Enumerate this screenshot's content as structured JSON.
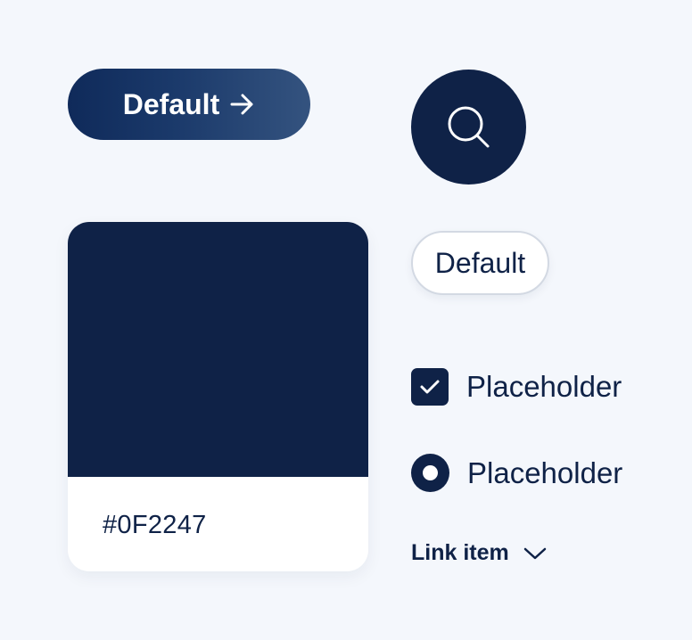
{
  "primary_button": {
    "label": "Default",
    "icon": "arrow-right-icon"
  },
  "search_button": {
    "icon": "search-icon"
  },
  "color_swatch": {
    "hex_label": "#0F2247",
    "color": "#0F2247"
  },
  "outline_button": {
    "label": "Default"
  },
  "checkbox": {
    "label": "Placeholder",
    "checked": true,
    "icon": "check-icon"
  },
  "radio": {
    "label": "Placeholder",
    "selected": true
  },
  "link_item": {
    "label": "Link item",
    "icon": "chevron-down-icon"
  },
  "colors": {
    "background": "#F4F7FC",
    "primary": "#0F2247",
    "surface": "#FFFFFF",
    "outline": "#D3D9E3"
  }
}
